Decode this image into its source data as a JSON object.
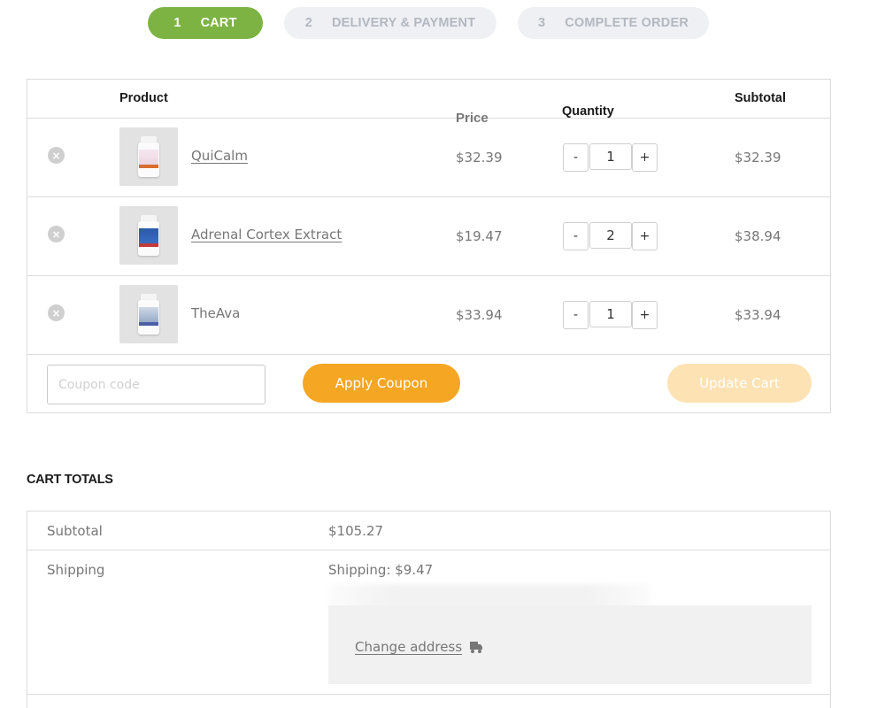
{
  "steps": [
    {
      "num": "1",
      "label": "CART",
      "active": true
    },
    {
      "num": "2",
      "label": "DELIVERY & PAYMENT",
      "active": false
    },
    {
      "num": "3",
      "label": "COMPLETE ORDER",
      "active": false
    }
  ],
  "cart": {
    "headers": {
      "product": "Product",
      "price": "Price",
      "quantity": "Quantity",
      "subtotal": "Subtotal"
    },
    "items": [
      {
        "name": "QuiCalm",
        "price": "$32.39",
        "quantity": "1",
        "subtotal": "$32.39",
        "linked": true
      },
      {
        "name": "Adrenal Cortex Extract",
        "price": "$19.47",
        "quantity": "2",
        "subtotal": "$38.94",
        "linked": true
      },
      {
        "name": "TheAva",
        "price": "$33.94",
        "quantity": "1",
        "subtotal": "$33.94",
        "linked": false
      }
    ],
    "qty_minus": "-",
    "qty_plus": "+",
    "remove_icon": "×"
  },
  "coupon": {
    "placeholder": "Coupon code",
    "apply_label": "Apply Coupon"
  },
  "update_label": "Update Cart",
  "totals": {
    "title": "CART TOTALS",
    "subtotal_label": "Subtotal",
    "subtotal_value": "$105.27",
    "shipping_label": "Shipping",
    "shipping_value": "Shipping: $9.47",
    "change_address": "Change address"
  },
  "colors": {
    "active_step": "#7cb342",
    "inactive_step": "#eef0f3",
    "apply_button": "#f5a623",
    "update_button_disabled": "#fde2b4"
  }
}
